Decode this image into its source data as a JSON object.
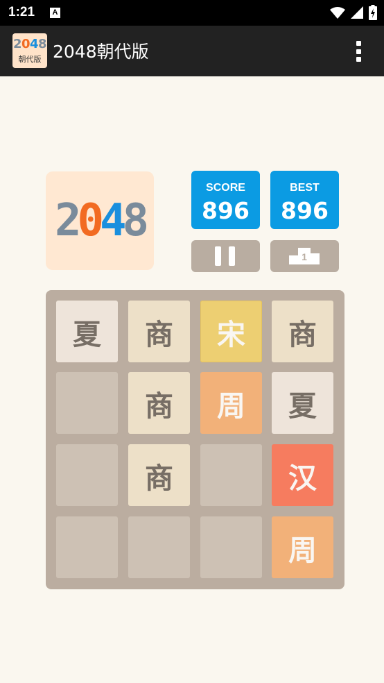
{
  "status_bar": {
    "time": "1:21",
    "notification_icon": "A"
  },
  "app_bar": {
    "title": "2048朝代版",
    "logo_number": "2048",
    "logo_subtitle": "朝代版",
    "menu_icon": "overflow-menu-icon"
  },
  "game": {
    "logo_digits": [
      "2",
      "0",
      "4",
      "8"
    ],
    "logo_colors": [
      "#7a8b9b",
      "#f26b22",
      "#1a8fde",
      "#7a8b9b"
    ],
    "score_label": "SCORE",
    "score_value": "896",
    "best_label": "BEST",
    "best_value": "896",
    "pause_icon": "pause-icon",
    "leaderboard_icon": "podium-icon",
    "leaderboard_rank": "1"
  },
  "board": {
    "rows": [
      [
        "夏",
        "商",
        "宋",
        "商"
      ],
      [
        "",
        "商",
        "周",
        "夏"
      ],
      [
        "",
        "商",
        "",
        "汉"
      ],
      [
        "",
        "",
        "",
        "周"
      ]
    ]
  },
  "colors": {
    "status_bar": "#000000",
    "app_bar": "#222222",
    "background": "#faf7ef",
    "score_box": "#0b9be3",
    "control_button": "#b9ada1",
    "board": "#bbada0",
    "empty_cell": "#cdc1b4"
  }
}
